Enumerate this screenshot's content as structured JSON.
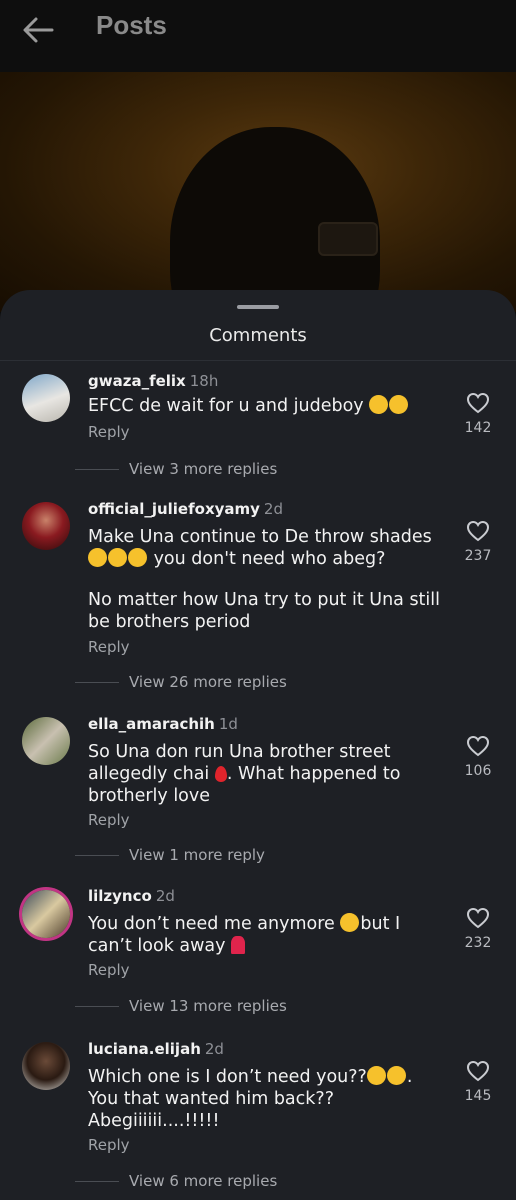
{
  "header": {
    "title": "Posts"
  },
  "sheet": {
    "title": "Comments"
  },
  "comments": [
    {
      "username": "gwaza_felix",
      "time": "18h",
      "text": "EFCC de wait for u and judeboy",
      "emoji": [
        "rofl",
        "joy"
      ],
      "likes": "142",
      "reply": "Reply",
      "more_replies": "View 3 more replies",
      "avatar_colors": [
        "#7fa7c9",
        "#e8e6e2"
      ]
    },
    {
      "username": "official_juliefoxyamy",
      "time": "2d",
      "line1": "Make Una continue to De throw shades",
      "line2": "you don't need who abeg?",
      "para2": "No matter how Una try to put it Una still be brothers period",
      "likes": "237",
      "reply": "Reply",
      "more_replies": "View 26 more replies",
      "avatar_colors": [
        "#7a1018",
        "#2a0a0a"
      ]
    },
    {
      "username": "ella_amarachih",
      "time": "1d",
      "text_a": "So Una don run Una brother street allegedly chai",
      "text_b": ". What happened to brotherly love",
      "likes": "106",
      "reply": "Reply",
      "more_replies": "View 1 more reply",
      "avatar_colors": [
        "#5a6a3a",
        "#c8c0b0"
      ]
    },
    {
      "username": "lilzynco",
      "time": "2d",
      "text_a": "You don’t need me  anymore",
      "text_b": "but I can’t look away",
      "likes": "232",
      "reply": "Reply",
      "more_replies": "View 13 more replies",
      "avatar_colors": [
        "#3b4a5a",
        "#d9c9a0"
      ]
    },
    {
      "username": "luciana.elijah",
      "time": "2d",
      "text_a": "Which one is I don’t need you??",
      "text_b": ". You that wanted him back?? Abegiiiiii....!!!!!",
      "likes": "145",
      "reply": "Reply",
      "more_replies": "View 6 more replies",
      "avatar_colors": [
        "#2a1a12",
        "#e0e0dc"
      ]
    }
  ]
}
